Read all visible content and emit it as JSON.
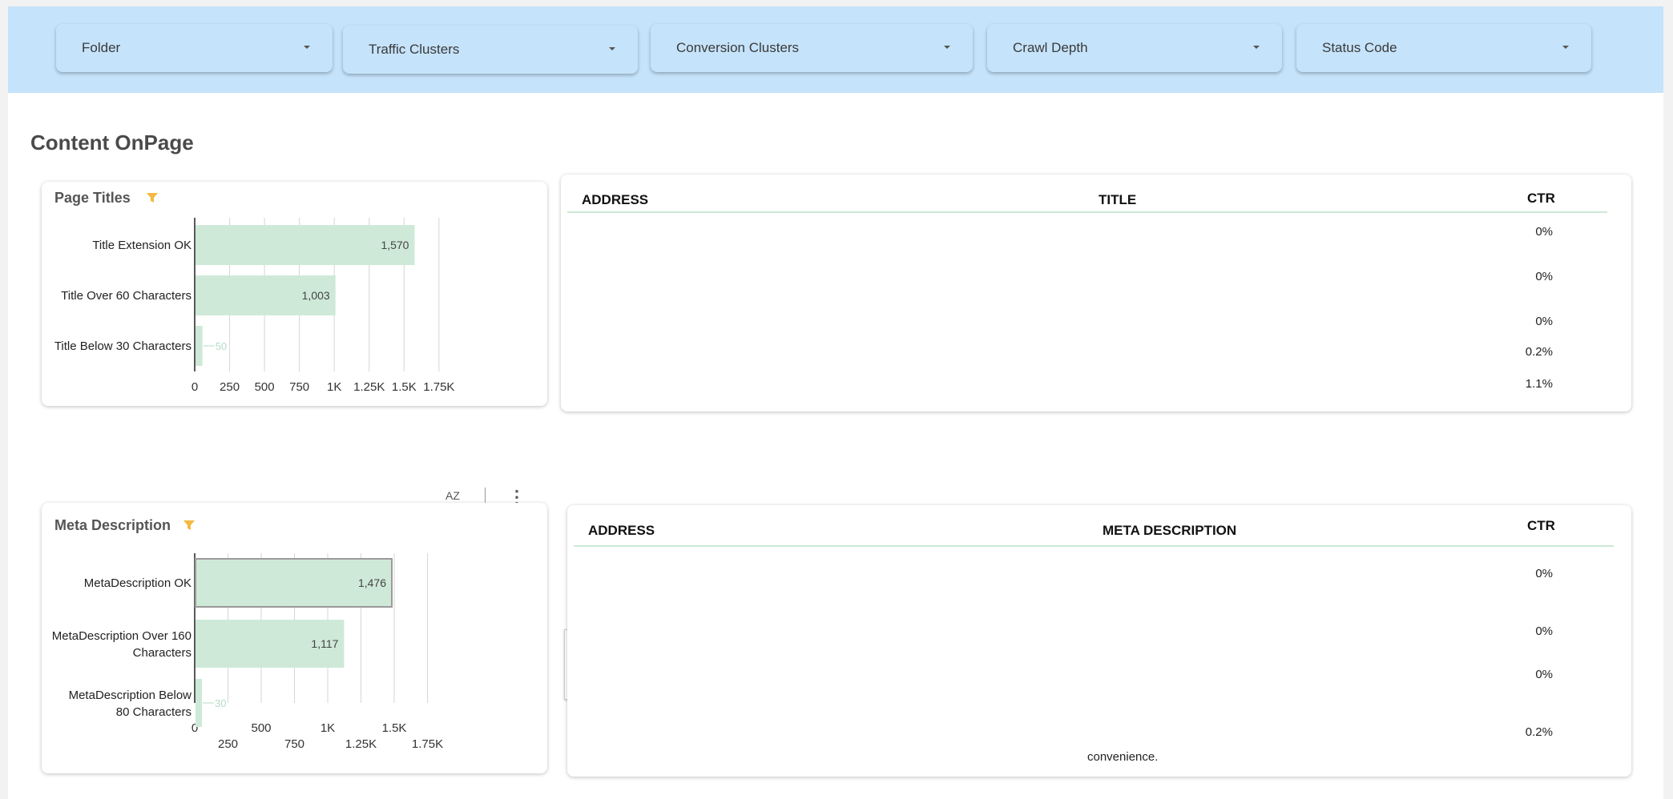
{
  "filters": [
    {
      "label": "Folder"
    },
    {
      "label": "Traffic Clusters"
    },
    {
      "label": "Conversion Clusters"
    },
    {
      "label": "Crawl Depth"
    },
    {
      "label": "Status Code"
    }
  ],
  "section_title": "Content OnPage",
  "page_titles_card": {
    "title": "Page Titles"
  },
  "meta_card": {
    "title": "Meta Description"
  },
  "toolbar": {
    "sort_icon": "AZ",
    "menu_icon": "⋮"
  },
  "titles_table": {
    "headers": [
      "ADDRESS",
      "TITLE",
      "CTR"
    ],
    "ctr_values": [
      "0%",
      "0%",
      "0%",
      "0.2%",
      "1.1%"
    ]
  },
  "meta_table": {
    "headers": [
      "ADDRESS",
      "META DESCRIPTION",
      "CTR"
    ],
    "ctr_values": [
      "0%",
      "0%",
      "0%",
      "0.2%"
    ],
    "overflow_text": "convenience."
  },
  "colors": {
    "bar": "#cfe9d8",
    "filter_icon": "#f5b942",
    "header_bg": "#c5e3fa"
  },
  "chart_data": [
    {
      "type": "bar",
      "orientation": "horizontal",
      "title": "Page Titles",
      "categories": [
        "Title Extension OK",
        "Title Over 60 Characters",
        "Title Below 30 Characters"
      ],
      "values": [
        1570,
        1003,
        50
      ],
      "value_labels": [
        "1,570",
        "1,003",
        "50"
      ],
      "xlim": [
        0,
        1750
      ],
      "ticks": [
        "0",
        "250",
        "500",
        "750",
        "1K",
        "1.25K",
        "1.5K",
        "1.75K"
      ],
      "grid": true
    },
    {
      "type": "bar",
      "orientation": "horizontal",
      "title": "Meta Description",
      "categories": [
        [
          "MetaDescription OK"
        ],
        [
          "MetaDescription Over 160",
          "Characters"
        ],
        [
          "MetaDescription Below",
          "80 Characters"
        ]
      ],
      "values": [
        1476,
        1117,
        30
      ],
      "value_labels": [
        "1,476",
        "1,117",
        "30"
      ],
      "xlim": [
        0,
        1750
      ],
      "ticks": [
        "0",
        "250",
        "500",
        "750",
        "1K",
        "1.25K",
        "1.5K",
        "1.75K"
      ],
      "grid": true
    }
  ]
}
